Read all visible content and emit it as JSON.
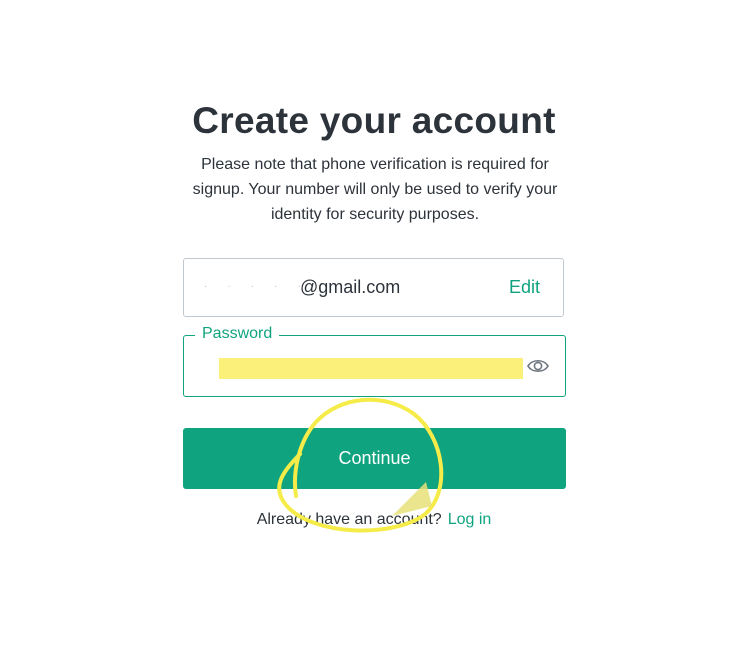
{
  "page": {
    "title": "Create your account",
    "subtitle": "Please note that phone verification is required for signup. Your number will only be used to verify your identity for security purposes."
  },
  "email": {
    "value": "@gmail.com",
    "edit_label": "Edit"
  },
  "password": {
    "label": "Password",
    "value": "",
    "toggle_icon": "eye-icon"
  },
  "actions": {
    "continue_label": "Continue"
  },
  "footer": {
    "prompt": "Already have an account?",
    "login_label": "Log in"
  },
  "colors": {
    "accent": "#10a37f",
    "text": "#2d333a",
    "border": "#c2c8d0",
    "highlight": "#f5ec4a"
  }
}
